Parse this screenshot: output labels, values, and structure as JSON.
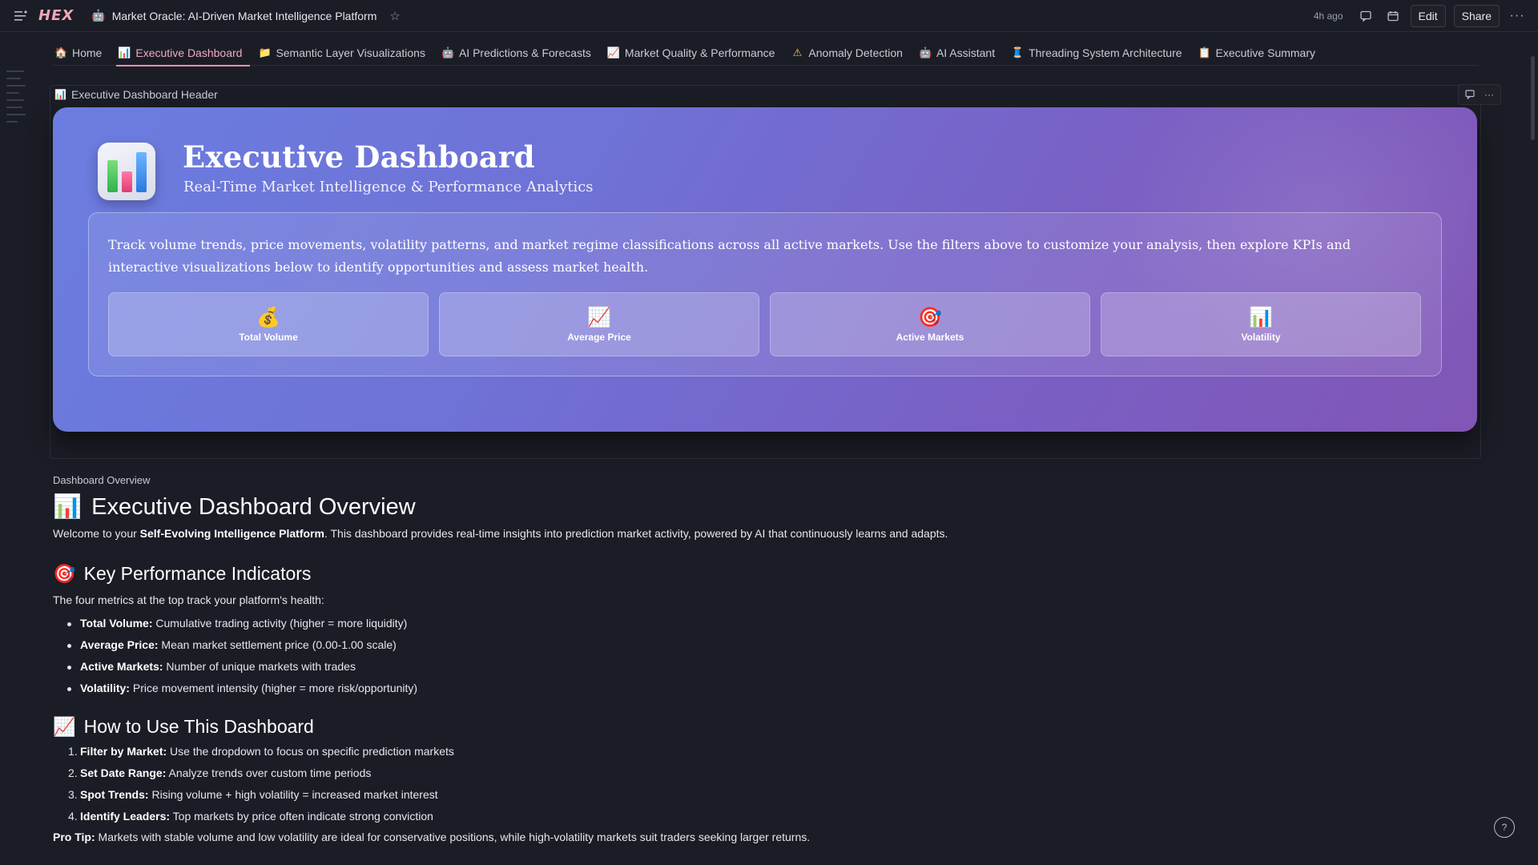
{
  "app": {
    "logo": "HEX",
    "title_icon": "🤖",
    "title": "Market Oracle: AI-Driven Market Intelligence Platform",
    "time_ago": "4h ago",
    "edit_label": "Edit",
    "share_label": "Share"
  },
  "tabs": [
    {
      "icon": "🏠",
      "label": "Home"
    },
    {
      "icon": "📊",
      "label": "Executive Dashboard"
    },
    {
      "icon": "📁",
      "label": "Semantic Layer Visualizations"
    },
    {
      "icon": "🤖",
      "label": "AI Predictions & Forecasts"
    },
    {
      "icon": "📈",
      "label": "Market Quality & Performance"
    },
    {
      "icon": "⚠",
      "label": "Anomaly Detection"
    },
    {
      "icon": "🤖",
      "label": "AI Assistant"
    },
    {
      "icon": "🧵",
      "label": "Threading System Architecture"
    },
    {
      "icon": "📋",
      "label": "Executive Summary"
    }
  ],
  "cell": {
    "icon": "📊",
    "label": "Executive Dashboard Header"
  },
  "hero": {
    "title": "Executive Dashboard",
    "subtitle": "Real-Time Market Intelligence & Performance Analytics",
    "description": "Track volume trends, price movements, volatility patterns, and market regime classifications across all active markets. Use the filters above to customize your analysis, then explore KPIs and interactive visualizations below to identify opportunities and assess market health.",
    "kpis": [
      {
        "icon": "💰",
        "label": "Total Volume"
      },
      {
        "icon": "📈",
        "label": "Average Price"
      },
      {
        "icon": "🎯",
        "label": "Active Markets"
      },
      {
        "icon": "📊",
        "label": "Volatility"
      }
    ]
  },
  "overview": {
    "cell_label": "Dashboard Overview",
    "heading_icon": "📊",
    "heading": "Executive Dashboard Overview",
    "intro_prefix": "Welcome to your ",
    "intro_bold": "Self-Evolving Intelligence Platform",
    "intro_suffix": ". This dashboard provides real-time insights into prediction market activity, powered by AI that continuously learns and adapts.",
    "kpi_heading_icon": "🎯",
    "kpi_heading": "Key Performance Indicators",
    "kpi_intro": "The four metrics at the top track your platform's health:",
    "kpi_items": [
      {
        "term": "Total Volume:",
        "text": " Cumulative trading activity (higher = more liquidity)"
      },
      {
        "term": "Average Price:",
        "text": " Mean market settlement price (0.00-1.00 scale)"
      },
      {
        "term": "Active Markets:",
        "text": " Number of unique markets with trades"
      },
      {
        "term": "Volatility:",
        "text": " Price movement intensity (higher = more risk/opportunity)"
      }
    ],
    "howto_heading_icon": "📈",
    "howto_heading": "How to Use This Dashboard",
    "howto_items": [
      {
        "num": "1.",
        "term": "Filter by Market:",
        "text": " Use the dropdown to focus on specific prediction markets"
      },
      {
        "num": "2.",
        "term": "Set Date Range:",
        "text": " Analyze trends over custom time periods"
      },
      {
        "num": "3.",
        "term": "Spot Trends:",
        "text": " Rising volume + high volatility = increased market interest"
      },
      {
        "num": "4.",
        "term": "Identify Leaders:",
        "text": " Top markets by price often indicate strong conviction"
      }
    ],
    "tip_term": "Pro Tip:",
    "tip_text": " Markets with stable volume and low volatility are ideal for conservative positions, while high-volatility markets suit traders seeking larger returns."
  }
}
